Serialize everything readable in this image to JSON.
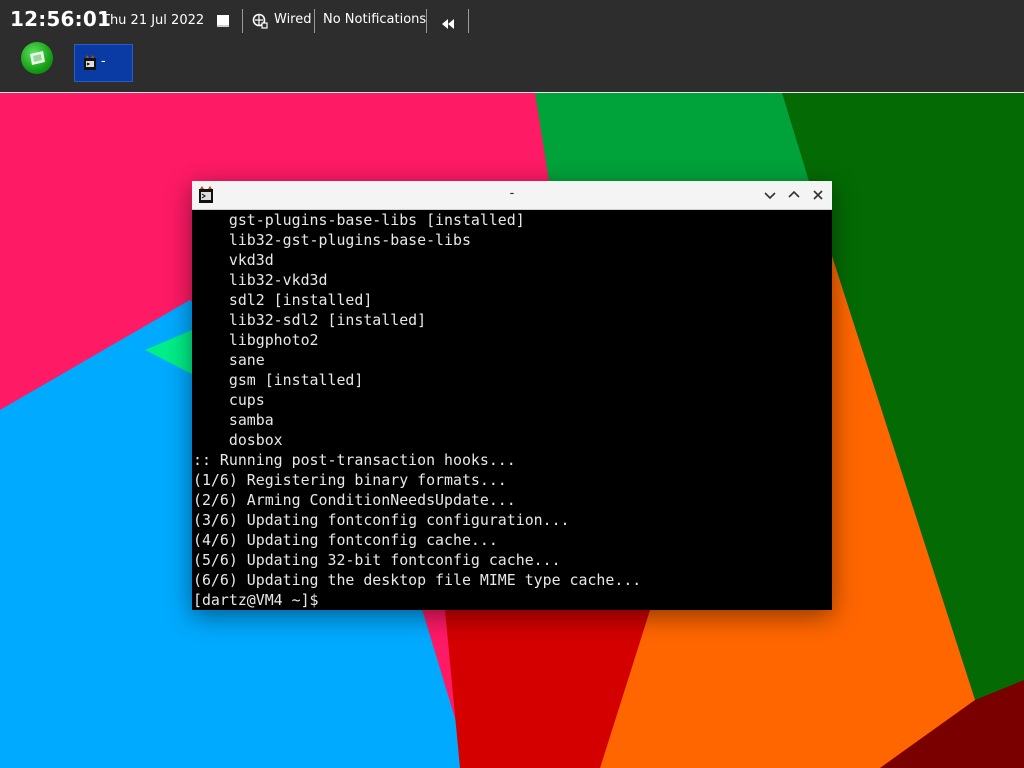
{
  "topbar": {
    "clock": "12:56:01",
    "date": "Thu 21 Jul 2022",
    "network": {
      "icon": "network-wired-icon",
      "label": "Wired"
    },
    "notifications": "No Notifications",
    "icons": [
      "window-icon",
      "rewind-icon"
    ]
  },
  "launcher": {
    "icon": "launcher-icon",
    "color": "#1aa31a"
  },
  "taskbar": {
    "items": [
      {
        "label": "-",
        "icon": "wine-terminal-icon",
        "active": true
      }
    ]
  },
  "terminal": {
    "title": "-",
    "icon": "wine-terminal-icon",
    "buttons": [
      "minimize-icon",
      "maximize-icon",
      "close-icon"
    ],
    "lines": [
      "    gst-plugins-base-libs [installed]",
      "    lib32-gst-plugins-base-libs",
      "    vkd3d",
      "    lib32-vkd3d",
      "    sdl2 [installed]",
      "    lib32-sdl2 [installed]",
      "    libgphoto2",
      "    sane",
      "    gsm [installed]",
      "    cups",
      "    samba",
      "    dosbox",
      ":: Running post-transaction hooks...",
      "(1/6) Registering binary formats...",
      "(2/6) Arming ConditionNeedsUpdate...",
      "(3/6) Updating fontconfig configuration...",
      "(4/6) Updating fontconfig cache...",
      "(5/6) Updating 32-bit fontconfig cache...",
      "(6/6) Updating the desktop file MIME type cache...",
      "[dartz@VM4 ~]$ "
    ]
  },
  "colors": {
    "panel": "#2d2d2d",
    "taskbar_active": "#0a3aa4",
    "terminal_bg": "#000000",
    "terminal_fg": "#e8e8e8",
    "wallpaper": [
      "#ff1a66",
      "#00a33a",
      "#046b04",
      "#00aaff",
      "#00ee88",
      "#ff6600",
      "#d40000",
      "#7a0000"
    ]
  }
}
